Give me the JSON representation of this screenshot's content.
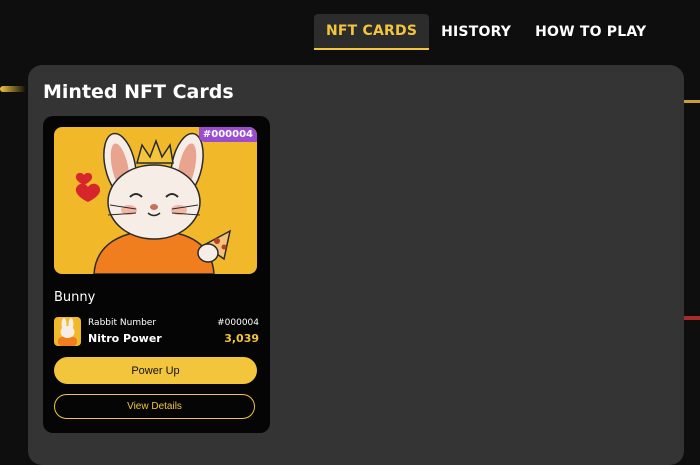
{
  "nav": {
    "tabs": [
      {
        "label": "NFT CARDS",
        "active": true
      },
      {
        "label": "HISTORY",
        "active": false
      },
      {
        "label": "HOW TO PLAY",
        "active": false
      }
    ]
  },
  "panel": {
    "title": "Minted NFT Cards"
  },
  "card": {
    "badge": "#000004",
    "name": "Bunny",
    "stat_label": "Rabbit Number",
    "stat_id": "#000004",
    "stat_name": "Nitro Power",
    "stat_value": "3,039",
    "power_up_label": "Power Up",
    "view_details_label": "View Details",
    "image": "rabbit-with-crown-eating-pizza"
  },
  "colors": {
    "accent": "#f2c53d",
    "badge": "#9b4dcf",
    "panel": "#343434",
    "background": "#0e0e0e"
  }
}
